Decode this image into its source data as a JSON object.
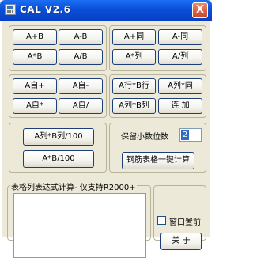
{
  "window": {
    "title": "CAL V2.6",
    "close_glyph": "X"
  },
  "group1": {
    "add": "A+B",
    "sub": "A-B",
    "mul": "A*B",
    "div": "A/B"
  },
  "group2": {
    "add_same": "A+同",
    "sub_same": "A-同",
    "mul_col": "A*列",
    "div_col": "A/列"
  },
  "group3": {
    "self_add": "A自+",
    "self_sub": "A自-",
    "self_mul": "A自*",
    "self_div": "A自/"
  },
  "group4": {
    "row_mul": "A行*B行",
    "col_mul_same": "A列*同",
    "col_mul_col": "A列*B列",
    "concat": "连 加"
  },
  "group5": {
    "col_pct": "A列*B列/100",
    "pct": "A*B/100"
  },
  "options": {
    "decimals_label": "保留小数位数",
    "decimals_value": "2",
    "steel_table": "钢筋表格一键计算"
  },
  "expression": {
    "title": "表格列表达式计算- 仅支持R2000+",
    "value": ""
  },
  "window_top": {
    "label": "窗口置前",
    "checked": false
  },
  "about": {
    "label": "关 于"
  },
  "icons": {
    "app": "calculator-icon",
    "close": "close-icon"
  }
}
